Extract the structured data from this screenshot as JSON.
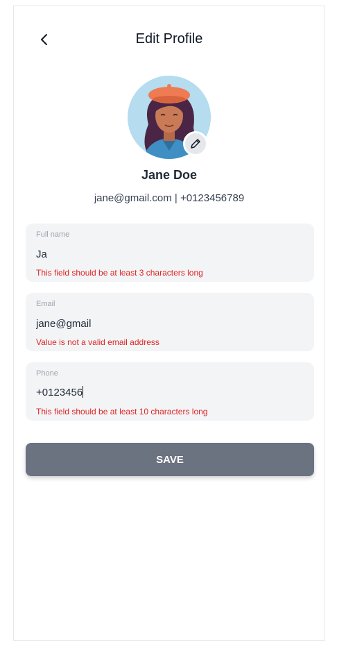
{
  "header": {
    "title": "Edit Profile",
    "back_icon": "chevron-left-icon"
  },
  "profile": {
    "name": "Jane Doe",
    "contact": "jane@gmail.com | +0123456789",
    "edit_icon": "pencil-icon"
  },
  "form": {
    "full_name": {
      "label": "Full name",
      "value": "Ja",
      "error": "This field should be at least 3 characters long"
    },
    "email": {
      "label": "Email",
      "value": "jane@gmail",
      "error": "Value is not a valid email address"
    },
    "phone": {
      "label": "Phone",
      "value": "+0123456",
      "error": "This field should be at least 10 characters long"
    }
  },
  "save_label": "SAVE",
  "colors": {
    "error": "#dc2626",
    "button": "#6b7280",
    "field_bg": "#f3f4f6"
  }
}
